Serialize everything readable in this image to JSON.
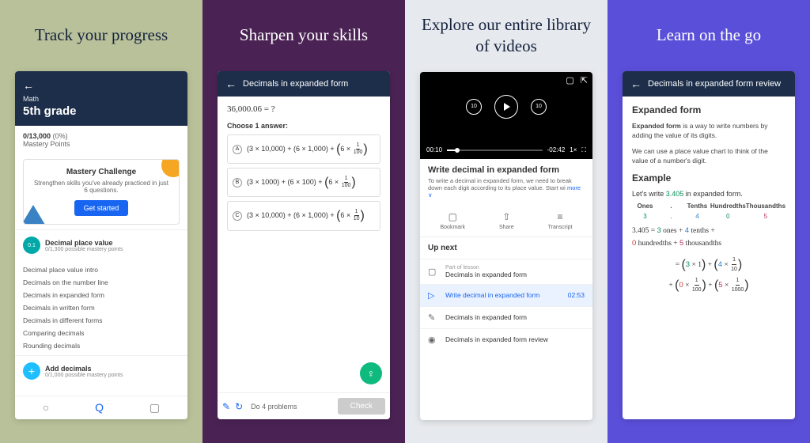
{
  "panels": {
    "p1": {
      "heading": "Track your progress"
    },
    "p2": {
      "heading": "Sharpen your skills"
    },
    "p3": {
      "heading": "Explore our entire library of videos"
    },
    "p4": {
      "heading": "Learn on the go"
    }
  },
  "progress": {
    "subject": "Math",
    "grade": "5th grade",
    "points": "0/13,000",
    "percent": "(0%)",
    "points_label": "Mastery Points",
    "challenge_title": "Mastery Challenge",
    "challenge_desc": "Strengthen skills you've already practiced in just 6 questions.",
    "get_started": "Get started",
    "section_name": "Decimal place value",
    "section_sub": "0/1,300 possible mastery points",
    "topics": [
      "Decimal place value intro",
      "Decimals on the number line",
      "Decimals in expanded form",
      "Decimals in written form",
      "Decimals in different forms",
      "Comparing decimals",
      "Rounding decimals"
    ],
    "section2_name": "Add decimals",
    "section2_sub": "0/1,000 possible mastery points"
  },
  "quiz": {
    "title": "Decimals in expanded form",
    "equation": "36,000.06 = ?",
    "choose": "Choose 1 answer:",
    "optA": "(3 × 10,000) + (6 × 1,000) +",
    "optA_tail": "6 ×",
    "optB": "(3 × 1000) + (6 × 100) +",
    "optC": "(3 × 10,000) + (6 × 1,000) +",
    "do4": "Do 4 problems",
    "check": "Check"
  },
  "video": {
    "time_cur": "00:10",
    "time_rem": "-02:42",
    "speed": "1×",
    "title": "Write decimal in expanded form",
    "desc": "To write a decimal in expanded form, we need to break down each digit according to its place value. Start wi",
    "more": "more ∨",
    "actions": {
      "bookmark": "Bookmark",
      "share": "Share",
      "transcript": "Transcript"
    },
    "upnext": "Up next",
    "lessons": [
      {
        "sub": "Part of lesson",
        "title": "Decimals in expanded form",
        "icon": "▢"
      },
      {
        "title": "Write decimal in expanded form",
        "time": "02:53",
        "icon": "▷",
        "hl": true
      },
      {
        "title": "Decimals in expanded form",
        "icon": "✎"
      },
      {
        "title": "Decimals in expanded form review",
        "icon": "◉"
      }
    ]
  },
  "article": {
    "title": "Decimals in expanded form review",
    "h": "Expanded form",
    "p1a": "Expanded form",
    "p1b": " is a way to write numbers by adding the value of its digits.",
    "p2": "We can use a place value chart to think of the value of a number's digit.",
    "example": "Example",
    "lets": "Let's write ",
    "num": "3.405",
    "lets2": " in expanded form.",
    "cols": [
      "Ones",
      ".",
      "Tenths",
      "Hundredths",
      "Thousandths"
    ],
    "vals": [
      "3",
      ".",
      "4",
      "0",
      "5"
    ],
    "line1": "3.405 = 3 ones + 4 tenths +",
    "line2": "0 hundredths + 5 thousandths"
  }
}
